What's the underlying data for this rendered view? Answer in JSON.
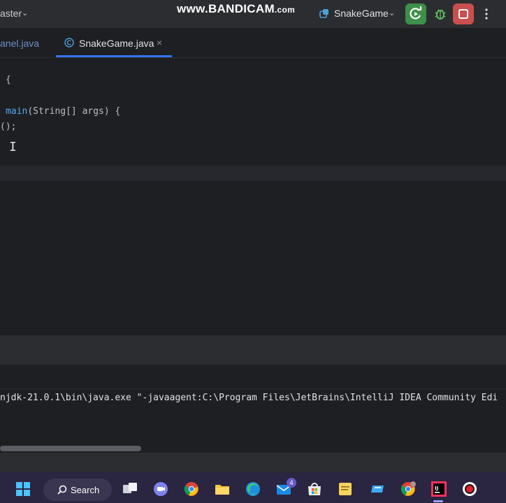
{
  "titlebar": {
    "branch": "aster",
    "watermark_main": "www.BANDICAM",
    "watermark_suffix": ".com",
    "run_config": "SnakeGame"
  },
  "tabs": {
    "panel_tab": "anel.java",
    "active_tab": "SnakeGame.java",
    "close_glyph": "×"
  },
  "editor": {
    "line1": "{",
    "line2_fn": "main",
    "line2_rest": "(String[] args) {",
    "line3": "();"
  },
  "console": {
    "line": "njdk-21.0.1\\bin\\java.exe \"-javaagent:C:\\Program Files\\JetBrains\\IntelliJ IDEA Community Edi"
  },
  "taskbar": {
    "search_label": "Search",
    "mail_badge": "4"
  },
  "colors": {
    "accent": "#3574f0",
    "run_green": "#3e8f4a",
    "stop_red": "#c94f4f",
    "method_blue": "#56a8f5"
  }
}
